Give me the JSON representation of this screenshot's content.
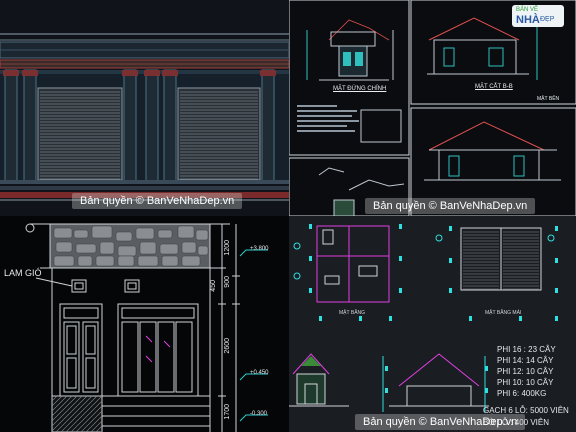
{
  "watermark": "Bản quyền © BanVeNhaDep.vn",
  "logo": {
    "line1": "BẢN VẼ",
    "line2": "NHÀ",
    "line3": "ĐẸP"
  },
  "panel_tr": {
    "label_facade": "MẶT ĐỨNG CHÍNH",
    "label_section": "MẶT CẮT B-B",
    "label_side": "MẶT BÊN"
  },
  "panel_bl": {
    "label_vent": "LAM GIÓ",
    "dims": [
      "1200",
      "1200",
      "2600",
      "1700",
      "900",
      "450"
    ],
    "levels": [
      "+3.800",
      "+0.450",
      "-0.300"
    ]
  },
  "panel_br": {
    "caption_plan": "MẶT BẰNG",
    "caption_roof": "MẶT BẰNG MÁI",
    "materials": [
      "PHI 16 : 23 CÂY",
      "PHI 14: 14 CÂY",
      "PHI 12: 10 CÂY",
      "PHI 10: 10 CÂY",
      "PHI 6: 400KG",
      "GẠCH 6 LỖ: 5000 VIÊN",
      "BỜ LỖ : 400 VIÊN"
    ]
  }
}
